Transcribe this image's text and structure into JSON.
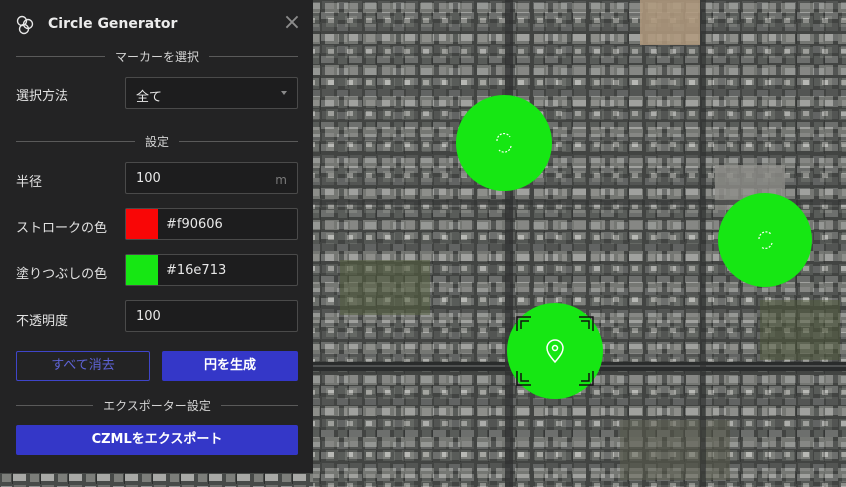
{
  "colors": {
    "panel_bg": "#232324",
    "accent": "#3437c8",
    "stroke": "#f90606",
    "fill": "#16e713"
  },
  "panel": {
    "title": "Circle Generator",
    "logo_icon": "circles-logo-icon",
    "close_icon": "close-icon"
  },
  "marker_section": {
    "heading": "マーカーを選択",
    "method_label": "選択方法",
    "method_value": "全て"
  },
  "settings_section": {
    "heading": "設定",
    "radius_label": "半径",
    "radius_value": "100",
    "radius_unit": "m",
    "stroke_label": "ストロークの色",
    "stroke_value": "#f90606",
    "fill_label": "塗りつぶしの色",
    "fill_value": "#16e713",
    "opacity_label": "不透明度",
    "opacity_value": "100"
  },
  "actions": {
    "clear_all": "すべて消去",
    "generate": "円を生成"
  },
  "export_section": {
    "heading": "エクスポーター設定",
    "export_button": "CZMLをエクスポート"
  },
  "map": {
    "circles": [
      {
        "id": "circle-1",
        "icon": "loading-spinner-icon",
        "selected": false
      },
      {
        "id": "circle-2",
        "icon": "loading-spinner-icon",
        "selected": false
      },
      {
        "id": "circle-3",
        "icon": "map-pin-icon",
        "selected": true
      }
    ]
  }
}
